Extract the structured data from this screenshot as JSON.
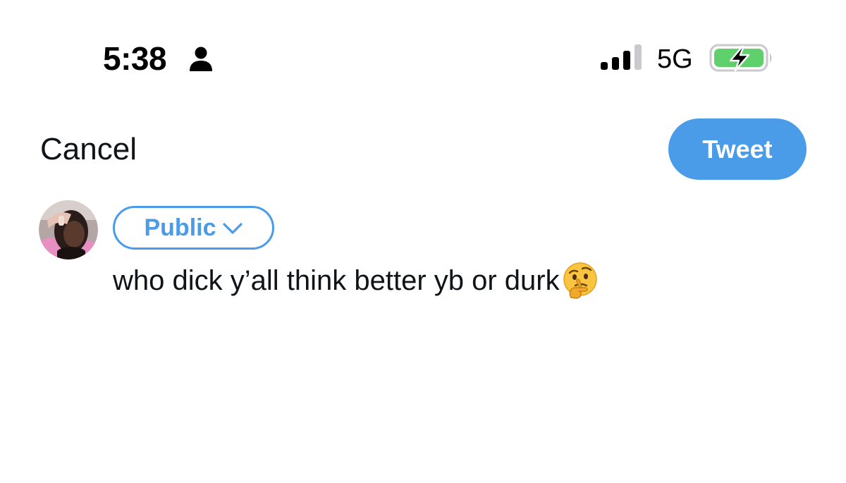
{
  "status_bar": {
    "time": "5:38",
    "network": "5G",
    "icons": [
      "person-icon",
      "signal-icon",
      "battery-charging-icon"
    ],
    "battery_color": "#5fd06b"
  },
  "compose": {
    "cancel_label": "Cancel",
    "tweet_label": "Tweet",
    "audience_label": "Public",
    "text": "who dick y’all think better yb or durk",
    "emoji": "thinking-face-icon"
  },
  "colors": {
    "accent": "#4a9ce9",
    "text": "#0f1419",
    "background": "#ffffff"
  }
}
